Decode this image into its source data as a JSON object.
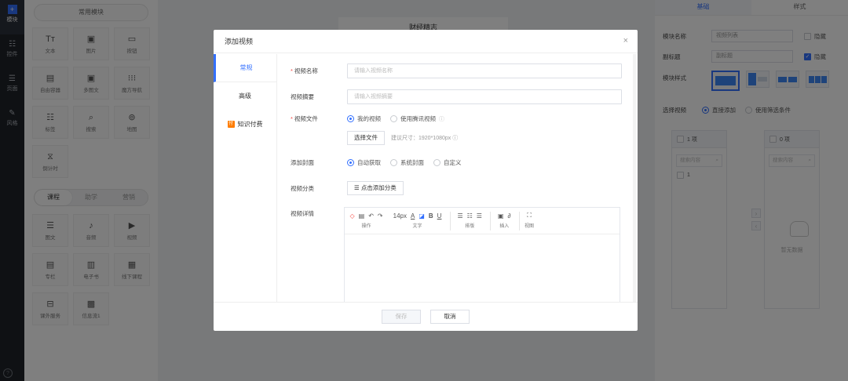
{
  "rail": {
    "items": [
      {
        "label": "模块",
        "icon": "plus-square-icon"
      },
      {
        "label": "控件",
        "icon": "sliders-icon"
      },
      {
        "label": "页面",
        "icon": "pages-icon"
      },
      {
        "label": "风格",
        "icon": "brush-icon"
      }
    ],
    "help": "?"
  },
  "modules": {
    "header": "常用模块",
    "common": [
      {
        "label": "文本",
        "icon": "Tт"
      },
      {
        "label": "图片",
        "icon": "▣"
      },
      {
        "label": "按钮",
        "icon": "▭"
      },
      {
        "label": "自由容器",
        "icon": "▤"
      },
      {
        "label": "多图文",
        "icon": "▣"
      },
      {
        "label": "魔方导航",
        "icon": "⁝⁝⁝"
      },
      {
        "label": "标签",
        "icon": "☷"
      },
      {
        "label": "搜索",
        "icon": "⌕"
      },
      {
        "label": "地图",
        "icon": "⊚"
      },
      {
        "label": "倒计时",
        "icon": "⧖"
      }
    ],
    "tabs": [
      "课程",
      "助学",
      "营销"
    ],
    "course": [
      {
        "label": "图文",
        "icon": "☰"
      },
      {
        "label": "音频",
        "icon": "♪"
      },
      {
        "label": "视频",
        "icon": "▶"
      },
      {
        "label": "专栏",
        "icon": "▤"
      },
      {
        "label": "电子书",
        "icon": "▥"
      },
      {
        "label": "线下课程",
        "icon": "▦"
      },
      {
        "label": "课外服务",
        "icon": "⊟"
      },
      {
        "label": "信息流1",
        "icon": "▩"
      }
    ]
  },
  "canvas": {
    "page_title": "财经精志"
  },
  "right_panel": {
    "tabs": [
      "基础",
      "样式"
    ],
    "module_name_label": "模块名称",
    "module_name_value": "视频列表",
    "hide_label": "隐藏",
    "subtitle_label": "副标题",
    "subtitle_value": "副标题",
    "style_label": "模块样式",
    "select_video_label": "选择视频",
    "direct_add": "直接添加",
    "use_filter": "使用筛选条件",
    "left_count": "1 项",
    "right_count": "0 项",
    "search_placeholder": "搜索内容",
    "left_item": "1",
    "empty_text": "暂无数据"
  },
  "dialog": {
    "title": "添加视频",
    "close": "×",
    "nav": [
      "常规",
      "高级",
      "知识付费"
    ],
    "nav_badge": "付",
    "fields": {
      "name_label": "视频名称",
      "name_placeholder": "请输入视频名称",
      "summary_label": "视频摘要",
      "summary_placeholder": "请输入视频摘要",
      "file_label": "视频文件",
      "file_opt1": "我的视频",
      "file_opt2": "使用腾讯视频",
      "choose_file": "选择文件",
      "size_hint": "建议尺寸：1920*1080px",
      "cover_label": "添加封面",
      "cover_opt1": "自动获取",
      "cover_opt2": "系统封面",
      "cover_opt3": "自定义",
      "category_label": "视频分类",
      "category_btn": "点击添加分类",
      "detail_label": "视频详情"
    },
    "toolbar": {
      "font_size": "14px",
      "groups": [
        "操作",
        "文字",
        "排版",
        "插入",
        "视图"
      ]
    },
    "footer": {
      "save": "保存",
      "cancel": "取消"
    }
  }
}
